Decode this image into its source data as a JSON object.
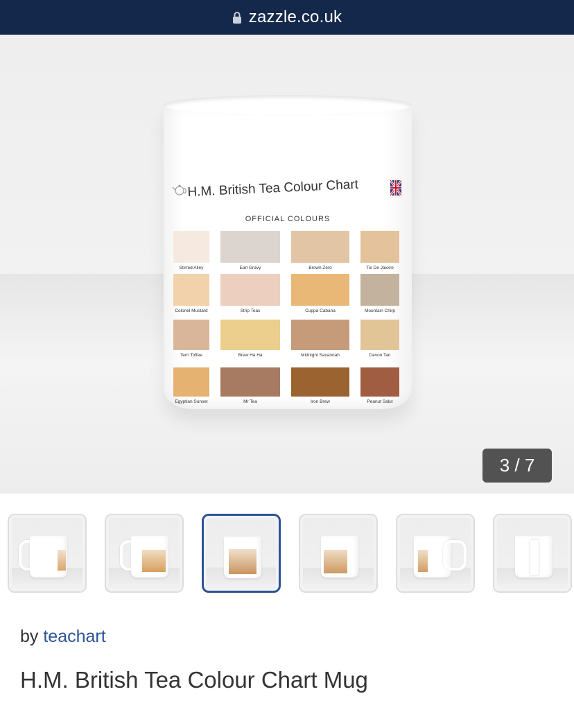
{
  "browser": {
    "url": "zazzle.co.uk"
  },
  "gallery": {
    "counter": "3 / 7",
    "product_image": {
      "chart_title": "H.M. British Tea Colour Chart",
      "chart_subtitle": "OFFICIAL COLOURS",
      "swatches": [
        {
          "name": "Stirred Alley",
          "color": "#f6e9df"
        },
        {
          "name": "Earl Gravy",
          "color": "#dcd5cf"
        },
        {
          "name": "Brown Zero",
          "color": "#e2c5a4"
        },
        {
          "name": "Tie De Jaxxre",
          "color": "#e4c29b"
        },
        {
          "name": "Colonel Mustard",
          "color": "#f2d2aa"
        },
        {
          "name": "Strip Teas",
          "color": "#edcfbf"
        },
        {
          "name": "Cuppa Cabana",
          "color": "#e9b877"
        },
        {
          "name": "Mountain Chirp",
          "color": "#c3b29e"
        },
        {
          "name": "Terri Toffee",
          "color": "#d9b699"
        },
        {
          "name": "Brew Ha Ha",
          "color": "#eccf8c"
        },
        {
          "name": "Midnight Savannah",
          "color": "#c59b7a"
        },
        {
          "name": "Devon Tan",
          "color": "#e2c597"
        },
        {
          "name": "Egyptian Sunset",
          "color": "#e6b272"
        },
        {
          "name": "Mr Tea",
          "color": "#a77b62"
        },
        {
          "name": "Iron Brew",
          "color": "#9a6330"
        },
        {
          "name": "Peanut Salut",
          "color": "#a15d42"
        }
      ]
    },
    "thumbnails": [
      {
        "label": "view 1",
        "active": false
      },
      {
        "label": "view 2",
        "active": false
      },
      {
        "label": "view 3",
        "active": true
      },
      {
        "label": "view 4",
        "active": false
      },
      {
        "label": "view 5",
        "active": false
      },
      {
        "label": "view 6",
        "active": false
      }
    ]
  },
  "product": {
    "by_prefix": "by",
    "designer": "teachart",
    "title": "H.M. British Tea Colour Chart Mug"
  },
  "colors": {
    "header_bg": "#14284b",
    "accent": "#2d5395"
  }
}
